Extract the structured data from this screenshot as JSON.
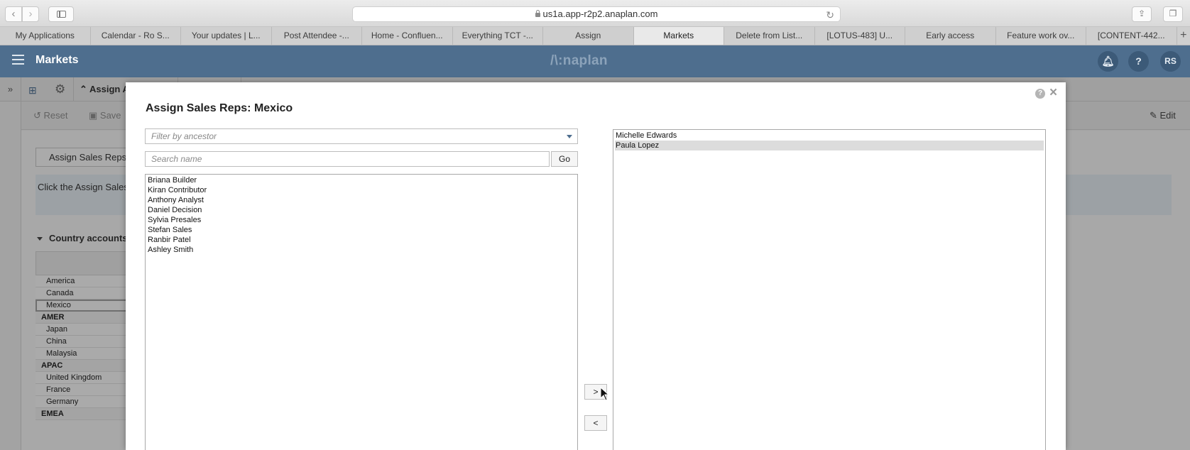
{
  "browser": {
    "url": "us1a.app-r2p2.anaplan.com",
    "tabs": [
      {
        "label": "My Applications"
      },
      {
        "label": "Calendar - Ro S..."
      },
      {
        "label": "Your updates | L..."
      },
      {
        "label": "Post Attendee -..."
      },
      {
        "label": "Home - Confluen..."
      },
      {
        "label": "Everything TCT -..."
      },
      {
        "label": "Assign"
      },
      {
        "label": "Markets"
      },
      {
        "label": "Delete from List..."
      },
      {
        "label": "[LOTUS-483] U..."
      },
      {
        "label": "Early access"
      },
      {
        "label": "Feature work ov..."
      },
      {
        "label": "[CONTENT-442..."
      }
    ],
    "active_tab": "Markets",
    "new_tab_label": "+"
  },
  "header": {
    "title": "Markets",
    "brand": "/\\:naplan",
    "help_label": "?",
    "avatar_initials": "RS"
  },
  "subbar": {
    "page_tab_label": "Assign A"
  },
  "actions": {
    "reset_label": "Reset",
    "save_label": "Save",
    "edit_label": "Edit"
  },
  "page": {
    "assign_button_label": "Assign Sales Reps",
    "instructions": "Click the Assign Sales",
    "grid_title": "Country accounts",
    "grid_rows": [
      {
        "label": "America",
        "group": false,
        "selected": false
      },
      {
        "label": "Canada",
        "group": false,
        "selected": false
      },
      {
        "label": "Mexico",
        "group": false,
        "selected": true
      },
      {
        "label": "AMER",
        "group": true,
        "selected": false
      },
      {
        "label": "Japan",
        "group": false,
        "selected": false
      },
      {
        "label": "China",
        "group": false,
        "selected": false
      },
      {
        "label": "Malaysia",
        "group": false,
        "selected": false
      },
      {
        "label": "APAC",
        "group": true,
        "selected": false
      },
      {
        "label": "United Kingdom",
        "group": false,
        "selected": false
      },
      {
        "label": "France",
        "group": false,
        "selected": false
      },
      {
        "label": "Germany",
        "group": false,
        "selected": false
      },
      {
        "label": "EMEA",
        "group": true,
        "selected": false
      }
    ]
  },
  "modal": {
    "title": "Assign Sales Reps: Mexico",
    "help_label": "?",
    "close_label": "×",
    "filter_placeholder": "Filter by ancestor",
    "search_placeholder": "Search name",
    "go_label": "Go",
    "add_label": ">",
    "remove_label": "<",
    "available": [
      {
        "label": "Briana Builder"
      },
      {
        "label": "Kiran Contributor"
      },
      {
        "label": "Anthony Analyst"
      },
      {
        "label": "Daniel Decision"
      },
      {
        "label": "Sylvia Presales"
      },
      {
        "label": "Stefan Sales"
      },
      {
        "label": "Ranbir Patel"
      },
      {
        "label": "Ashley Smith"
      }
    ],
    "selected": [
      {
        "label": "Michelle Edwards",
        "highlighted": false
      },
      {
        "label": "Paula Lopez",
        "highlighted": true
      }
    ]
  },
  "colors": {
    "header_bg": "#4e6e8e",
    "selection_bg": "#dcdcdc"
  }
}
